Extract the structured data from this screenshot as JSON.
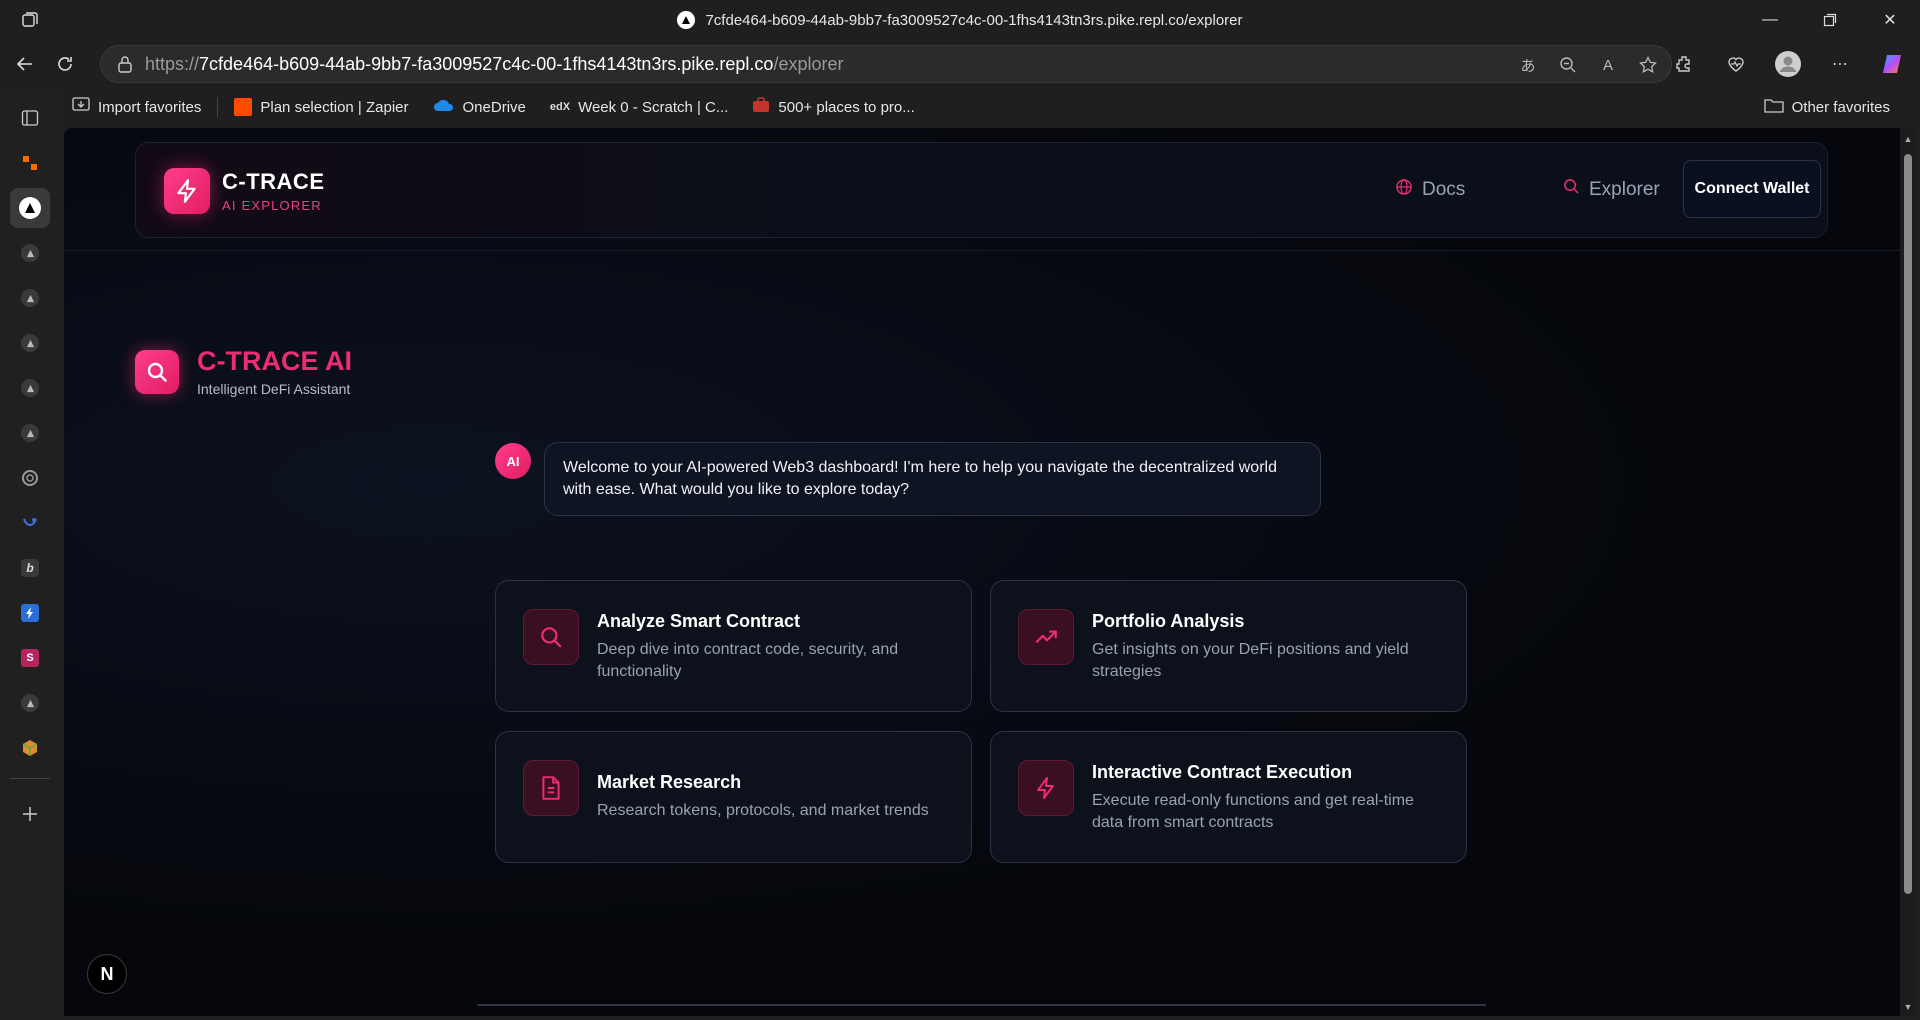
{
  "browser": {
    "tab_title": "7cfde464-b609-44ab-9bb7-fa3009527c4c-00-1fhs4143tn3rs.pike.repl.co/explorer",
    "url_prefix": "https://",
    "url_host": "7cfde464-b609-44ab-9bb7-fa3009527c4c-00-1fhs4143tn3rs.pike.repl.co",
    "url_path": "/explorer"
  },
  "favorites": {
    "items": [
      {
        "label": "Import favorites",
        "icon": "import-icon"
      },
      {
        "label": "Plan selection | Zapier",
        "icon": "zapier-icon"
      },
      {
        "label": "OneDrive",
        "icon": "onedrive-icon"
      },
      {
        "label": "Week 0 - Scratch | C...",
        "icon": "edx-icon"
      },
      {
        "label": "500+ places to pro...",
        "icon": "briefcase-icon"
      }
    ],
    "other": "Other favorites"
  },
  "app": {
    "brand_name": "C-TRACE",
    "brand_sub": "AI EXPLORER",
    "nav_docs": "Docs",
    "nav_explorer": "Explorer",
    "connect_wallet": "Connect Wallet",
    "ai_title": "C-TRACE AI",
    "ai_subtitle": "Intelligent DeFi Assistant",
    "avatar_label": "AI",
    "welcome_message": "Welcome to your AI-powered Web3 dashboard! I'm here to help you navigate the decentralized world with ease. What would you like to explore today?",
    "accent_color": "#ec2d72"
  },
  "cards": [
    {
      "title": "Analyze Smart Contract",
      "description": "Deep dive into contract code, security, and functionality",
      "icon": "search-icon"
    },
    {
      "title": "Portfolio Analysis",
      "description": "Get insights on your DeFi positions and yield strategies",
      "icon": "trending-up-icon"
    },
    {
      "title": "Market Research",
      "description": "Research tokens, protocols, and market trends",
      "icon": "document-icon"
    },
    {
      "title": "Interactive Contract Execution",
      "description": "Execute read-only functions and get real-time data from smart contracts",
      "icon": "lightning-icon"
    }
  ],
  "next_badge": "N"
}
